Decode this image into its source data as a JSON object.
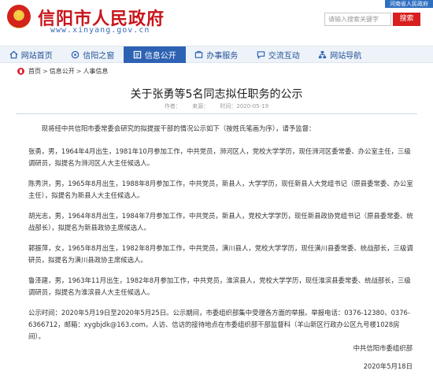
{
  "header": {
    "site_title": "信阳市人民政府",
    "site_url": "www.xinyang.gov.cn",
    "portal_tag": "河南省人民政府",
    "search_placeholder": "请输入搜索关键字",
    "search_button": "搜索"
  },
  "nav": [
    {
      "label": "网站首页",
      "icon": "home-icon"
    },
    {
      "label": "信阳之窗",
      "icon": "window-icon"
    },
    {
      "label": "信息公开",
      "icon": "info-icon",
      "active": true
    },
    {
      "label": "办事服务",
      "icon": "service-icon"
    },
    {
      "label": "交流互动",
      "icon": "chat-icon"
    },
    {
      "label": "网站导航",
      "icon": "sitemap-icon"
    }
  ],
  "breadcrumb": {
    "items": [
      "首页",
      "信息公开",
      "人事信息"
    ]
  },
  "article": {
    "title": "关于张勇等5名同志拟任职务的公示",
    "meta_author": "作者：",
    "meta_source": "来源：",
    "meta_date": "时间：2020-05-19",
    "intro": "现将经中共信阳市委常委会研究的拟提拔干部的情况公示如下（按姓氏笔画为序），请予监督：",
    "candidates": [
      "张勇，男，1964年4月出生，1981年10月参加工作，中共党员，浉河区人，党校大学学历，现任浉河区委常委、办公室主任，三级调研员，拟提名为浉河区人大主任候选人。",
      "陈秀洪，男，1965年8月出生，1988年8月参加工作，中共党员，新县人，大学学历，现任新县人大党组书记（原县委常委、办公室主任），拟提名为新县人大主任候选人。",
      "胡光志，男，1964年8月出生，1984年7月参加工作，中共党员，新县人，党校大学学历，现任新县政协党组书记（原县委常委、统战部长），拟提名为新县政协主席候选人。",
      "郭振萍，女，1965年8月出生，1982年8月参加工作，中共党员，潢川县人，党校大学学历，现任潢川县委常委、统战部长，三级调研员，拟提名为潢川县政协主席候选人。",
      "鲁泽建，男，1963年11月出生，1982年8月参加工作，中共党员，淮滨县人，党校大学学历，现任淮滨县委常委、统战部长，三级调研员，拟提名为淮滨县人大主任候选人。"
    ],
    "notice": "公示时间：2020年5月19日至2020年5月25日。公示期间，市委组织部集中受理各方面的举报。举报电话：0376-12380、0376-6366712，邮箱：xygbjdk@163.com。人访、信访的接待地点在市委组织部干部监督科（羊山新区行政办公区九号楼1028房间）。",
    "signer": "中共信阳市委组织部",
    "sign_date": "2020年5月18日"
  },
  "colors": {
    "brand_red": "#c8161d",
    "nav_active": "#2d62b3",
    "nav_bg": "#eef3f9",
    "link_blue": "#3a6cb2"
  }
}
